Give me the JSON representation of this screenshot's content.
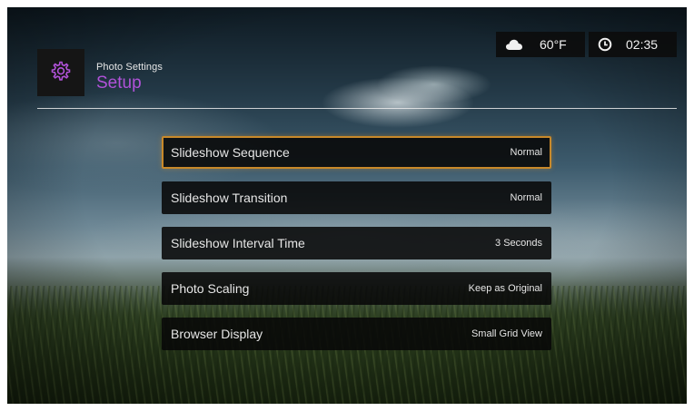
{
  "header": {
    "section": "Photo Settings",
    "title": "Setup",
    "icon": "gear-icon"
  },
  "status": {
    "weather_icon": "cloud-icon",
    "temperature": "60°F",
    "clock_icon": "clock-icon",
    "time": "02:35"
  },
  "menu": {
    "items": [
      {
        "label": "Slideshow Sequence",
        "value": "Normal"
      },
      {
        "label": "Slideshow Transition",
        "value": "Normal"
      },
      {
        "label": "Slideshow Interval Time",
        "value": "3 Seconds"
      },
      {
        "label": "Photo Scaling",
        "value": "Keep as Original"
      },
      {
        "label": "Browser Display",
        "value": "Small Grid View"
      }
    ],
    "selected_index": 0
  },
  "colors": {
    "accent": "#b052d8",
    "selection_border": "#c8892a"
  }
}
